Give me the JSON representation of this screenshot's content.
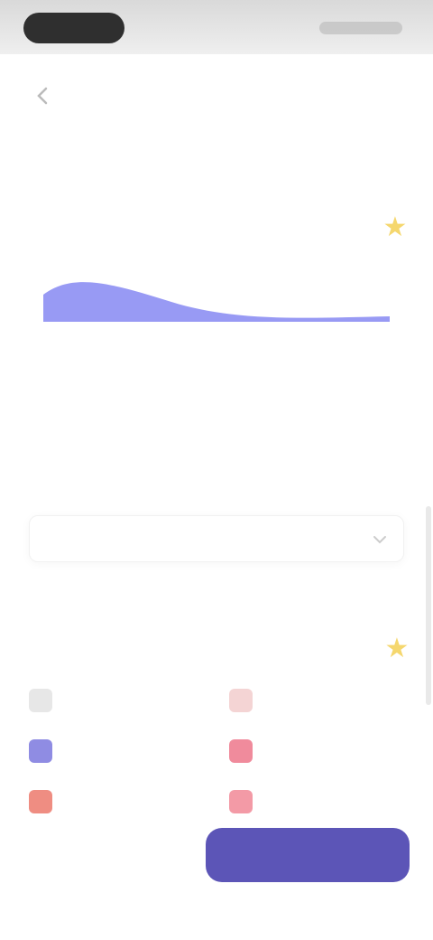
{
  "header": {
    "title": "",
    "subtitle": ""
  },
  "sections": {
    "parameters_title": "",
    "select_title": "",
    "settings_title": ""
  },
  "curve": {
    "accent": "#7b7ff0"
  },
  "range": {
    "left_caption": "",
    "left_value": "",
    "right_caption": "",
    "right_value": ""
  },
  "select": {
    "value": ""
  },
  "grid": [
    {
      "label": "",
      "count": "",
      "color": "#e7e7e7"
    },
    {
      "label": "",
      "count": "",
      "color": "#f4d4d4"
    },
    {
      "label": "",
      "count": "",
      "color": "#8f8ce3"
    },
    {
      "label": "",
      "count": "",
      "color": "#f08b9c"
    },
    {
      "label": "",
      "count": "",
      "color": "#ef8d82"
    },
    {
      "label": "",
      "count": "",
      "color": "#f39aa6"
    }
  ],
  "footer": {
    "text": "",
    "button_label": ""
  },
  "icons": {
    "back": "chevron-left-icon",
    "star": "star-icon",
    "chevron": "chevron-down-icon"
  },
  "colors": {
    "primary": "#5c55b7",
    "star": "#f5d76e"
  }
}
